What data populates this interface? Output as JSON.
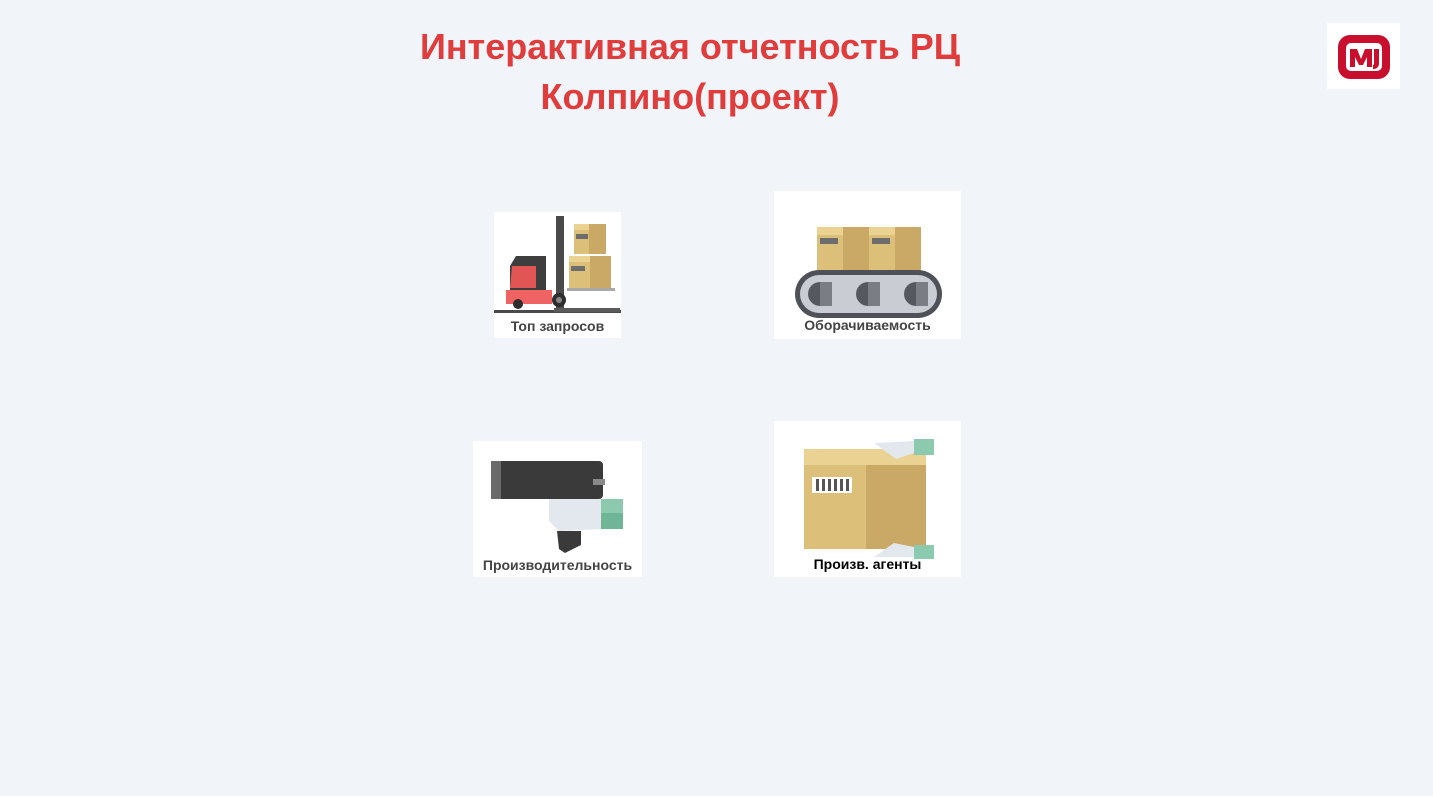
{
  "header": {
    "title_line1": "Интерактивная отчетность РЦ",
    "title_line2": "Колпино(проект)"
  },
  "brand": {
    "logo_text": "М",
    "accent_color": "#e03c3c",
    "logo_color": "#c8102e"
  },
  "tiles": [
    {
      "label": "Топ запросов",
      "icon": "forklift-icon"
    },
    {
      "label": "Оборачиваемость",
      "icon": "conveyor-belt-icon"
    },
    {
      "label": "Производительность",
      "icon": "barcode-scanner-icon"
    },
    {
      "label": "Произв. агенты",
      "icon": "box-carry-icon"
    }
  ]
}
